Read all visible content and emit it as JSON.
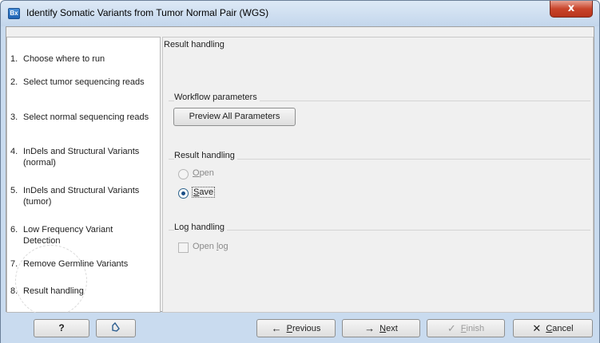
{
  "window": {
    "app_icon_text": "Bx",
    "title": "Identify Somatic Variants from Tumor Normal Pair (WGS)",
    "close_glyph": "x"
  },
  "steps": [
    {
      "num": "1.",
      "label": "Choose where to run"
    },
    {
      "num": "2.",
      "label": "Select tumor sequencing reads"
    },
    {
      "num": "3.",
      "label": "Select normal sequencing reads"
    },
    {
      "num": "4.",
      "label": "InDels and Structural Variants (normal)"
    },
    {
      "num": "5.",
      "label": "InDels and Structural Variants (tumor)"
    },
    {
      "num": "6.",
      "label": "Low Frequency Variant Detection"
    },
    {
      "num": "7.",
      "label": "Remove Germline Variants"
    },
    {
      "num": "8.",
      "label": "Result handling"
    }
  ],
  "panel": {
    "title": "Result handling",
    "workflow_group": {
      "label": "Workflow parameters",
      "preview_button": "Preview All Parameters"
    },
    "result_group": {
      "label": "Result handling",
      "open_option": {
        "mnemonic": "O",
        "rest": "pen",
        "checked": false,
        "enabled": false
      },
      "save_option": {
        "mnemonic": "S",
        "rest": "ave",
        "checked": true,
        "enabled": true
      }
    },
    "log_group": {
      "label": "Log handling",
      "open_log": {
        "before": "Open ",
        "mnemonic": "l",
        "rest": "og",
        "checked": false,
        "enabled": false
      }
    }
  },
  "footer": {
    "help_label": "?",
    "reset_icon": "reset-icon",
    "previous": {
      "icon": "←",
      "mnemonic": "P",
      "rest": "revious"
    },
    "next": {
      "icon": "→",
      "mnemonic": "N",
      "rest": "ext"
    },
    "finish": {
      "icon": "✓",
      "mnemonic": "F",
      "rest": "inish",
      "enabled": false
    },
    "cancel": {
      "icon": "✕",
      "mnemonic": "C",
      "rest": "ancel"
    }
  }
}
